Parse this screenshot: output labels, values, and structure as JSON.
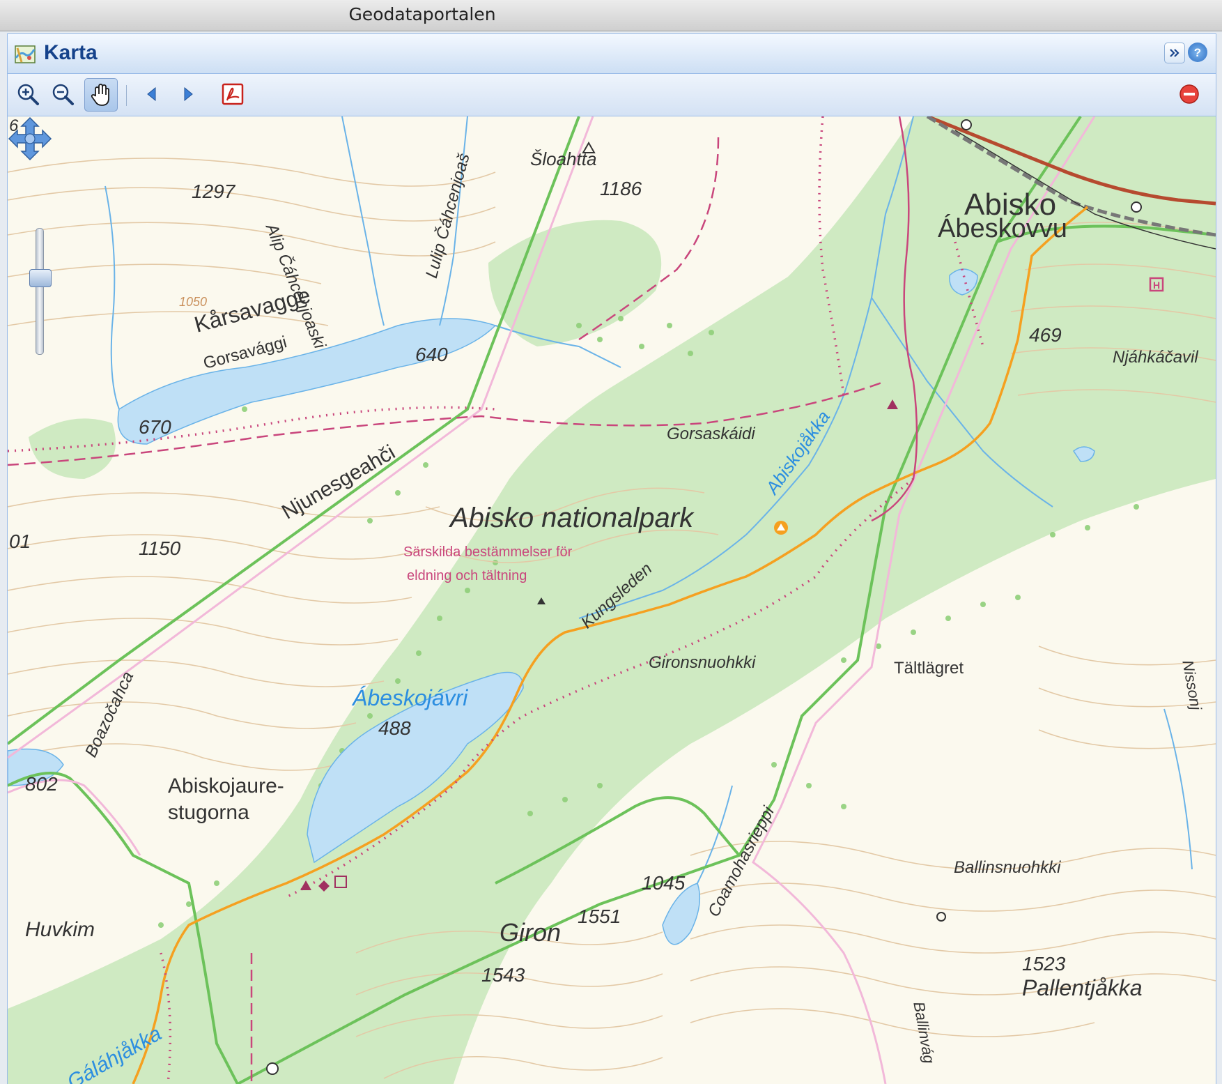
{
  "window": {
    "title": "Geodataportalen"
  },
  "panel": {
    "title": "Karta"
  },
  "toolbar": {
    "buttons": [
      {
        "icon": "zoom-in-icon",
        "pressed": true
      },
      {
        "icon": "zoom-out-icon",
        "pressed": false
      },
      {
        "icon": "pan-hand-icon",
        "pressed": true
      },
      {
        "icon": "back-arrow-icon",
        "pressed": false
      },
      {
        "icon": "forward-arrow-icon",
        "pressed": false
      },
      {
        "icon": "pdf-icon",
        "pressed": false
      },
      {
        "icon": "remove-icon",
        "pressed": false
      }
    ]
  },
  "map": {
    "colors": {
      "background": "#fbf9ee",
      "forest": "#cfeac2",
      "water": "#bfe0f6",
      "contour": "#e3c9a6",
      "boundary": "#6cc25a",
      "trail": "#f5a020",
      "path": "#c9467c"
    },
    "labels": [
      {
        "text": "Šloahtta"
      },
      {
        "text": "1186"
      },
      {
        "text": "1297"
      },
      {
        "text": "Alip Čáhcenjoaski"
      },
      {
        "text": "Lulip Čáhcenjoaš"
      },
      {
        "text": "Abisko"
      },
      {
        "text": "Ábeskovvu"
      },
      {
        "text": "1050"
      },
      {
        "text": "Kårsavagge"
      },
      {
        "text": "Gorsavággi"
      },
      {
        "text": "640"
      },
      {
        "text": "469"
      },
      {
        "text": "Njáhkáčavil"
      },
      {
        "text": "670"
      },
      {
        "text": "Gorsaskáidi"
      },
      {
        "text": "Abiskojåkka"
      },
      {
        "text": "Njunesgeahči"
      },
      {
        "text": "Abisko nationalpark"
      },
      {
        "text": "Särskilda bestämmelser för"
      },
      {
        "text": "eldning och tältning"
      },
      {
        "text": "1150"
      },
      {
        "text": "01"
      },
      {
        "text": "Kungsleden"
      },
      {
        "text": "Gironsnuohkki"
      },
      {
        "text": "Tältlägret"
      },
      {
        "text": "Nissonj"
      },
      {
        "text": "Boazočahca"
      },
      {
        "text": "Ábeskojávri"
      },
      {
        "text": "488"
      },
      {
        "text": "802"
      },
      {
        "text": "Abiskojaure-"
      },
      {
        "text": "stugorna"
      },
      {
        "text": "Coamohasrieppi"
      },
      {
        "text": "Ballinsnuohkki"
      },
      {
        "text": "1045"
      },
      {
        "text": "1551"
      },
      {
        "text": "Giron"
      },
      {
        "text": "Huvkim"
      },
      {
        "text": "1543"
      },
      {
        "text": "Ballinvág"
      },
      {
        "text": "1523"
      },
      {
        "text": "Pallentjåkka"
      },
      {
        "text": "Gáláhjåkka"
      },
      {
        "text": "6"
      }
    ],
    "navigation": {
      "pan_control": "pan-arrows-icon",
      "zoom_level": 0.38
    }
  }
}
